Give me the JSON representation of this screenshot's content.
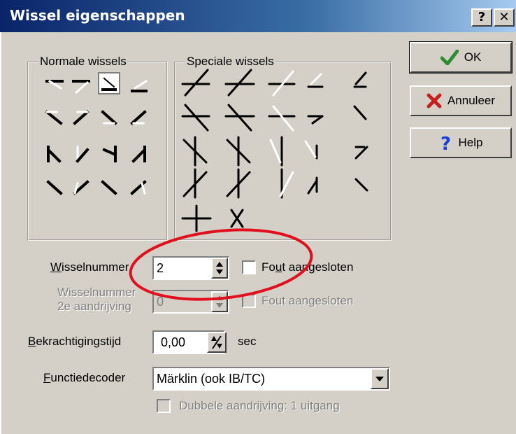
{
  "window": {
    "title": "Wissel eigenschappen",
    "help_caption": "?",
    "close_caption": "✕"
  },
  "groups": {
    "normal": "Normale wissels",
    "special": "Speciale wissels"
  },
  "buttons": {
    "ok": "OK",
    "cancel": "Annuleer",
    "help": "Help"
  },
  "form": {
    "switch_number_label_pre": "W",
    "switch_number_label_post": "isselnummer",
    "switch_number_value": "2",
    "wrong_connected_pre": "F",
    "wrong_connected_mid": "o",
    "wrong_connected_u": "u",
    "wrong_connected_post": "t aangesloten",
    "switch_number2_line1": "Wisselnummer",
    "switch_number2_line2": "2e aandrijving",
    "switch_number2_value": "0",
    "wrong_connected2": "Fout aangesloten",
    "activation_label_pre": "B",
    "activation_label_post": "ekrachtigingstijd",
    "activation_value": "0,00",
    "activation_unit": "sec",
    "decoder_label_pre": "F",
    "decoder_label_post": "unctiedecoder",
    "decoder_value": "Märklin (ook IB/TC)",
    "double_drive": "Dubbele aandrijving: 1 uitgang"
  },
  "colors": {
    "ok_check": "#2e8b2e",
    "cancel_x": "#c81e1e",
    "help_q": "#1a3fd6",
    "annotation": "#e0101e"
  }
}
